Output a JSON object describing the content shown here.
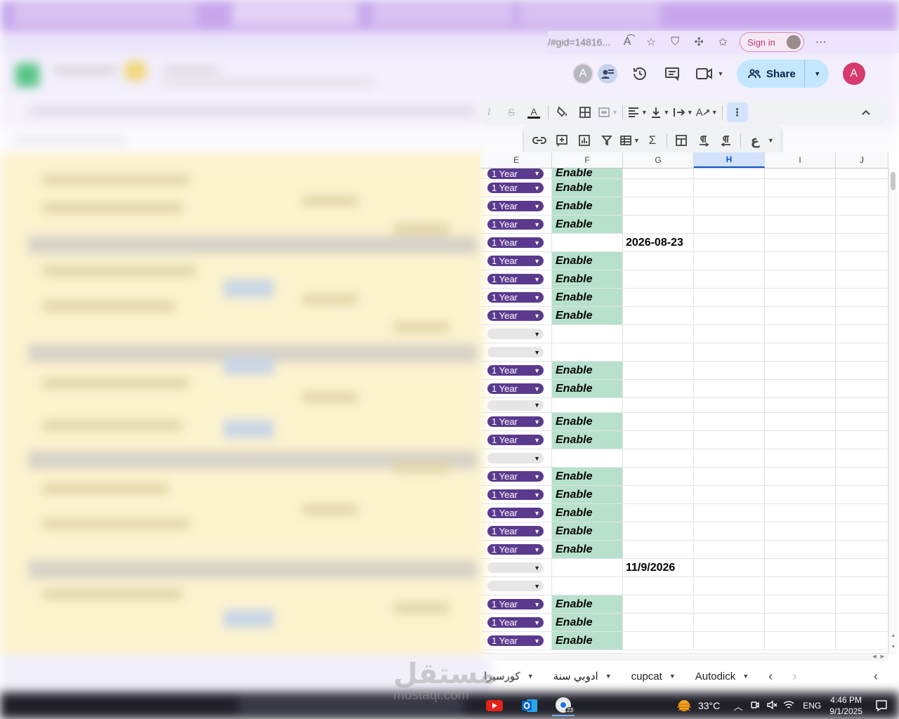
{
  "browser": {
    "url_fragment": "/#gid=14816...",
    "signin_label": "Sign in"
  },
  "header": {
    "avatar_letter": "A",
    "share_label": "Share",
    "account_letter": "A"
  },
  "columns": [
    "E",
    "F",
    "G",
    "H",
    "I",
    "J"
  ],
  "selected_column": "H",
  "rows": [
    {
      "chip": "1 Year",
      "f": "Enable",
      "g": ""
    },
    {
      "chip": "1 Year",
      "f": "Enable",
      "g": ""
    },
    {
      "chip": "1 Year",
      "f": "Enable",
      "g": ""
    },
    {
      "chip": "1 Year",
      "f": "Enable",
      "g": ""
    },
    {
      "chip": "1 Year",
      "f": "",
      "g": "2026-08-23"
    },
    {
      "chip": "1 Year",
      "f": "Enable",
      "g": ""
    },
    {
      "chip": "1 Year",
      "f": "Enable",
      "g": ""
    },
    {
      "chip": "1 Year",
      "f": "Enable",
      "g": ""
    },
    {
      "chip": "1 Year",
      "f": "Enable",
      "g": ""
    },
    {
      "chip": "",
      "f": "",
      "g": ""
    },
    {
      "chip": "",
      "f": "",
      "g": ""
    },
    {
      "chip": "1 Year",
      "f": "Enable",
      "g": ""
    },
    {
      "chip": "1 Year",
      "f": "Enable",
      "g": ""
    },
    {
      "chip": "",
      "f": "",
      "g": ""
    },
    {
      "chip": "1 Year",
      "f": "Enable",
      "g": ""
    },
    {
      "chip": "1 Year",
      "f": "Enable",
      "g": ""
    },
    {
      "chip": "",
      "f": "",
      "g": ""
    },
    {
      "chip": "1 Year",
      "f": "Enable",
      "g": ""
    },
    {
      "chip": "1 Year",
      "f": "Enable",
      "g": ""
    },
    {
      "chip": "1 Year",
      "f": "Enable",
      "g": ""
    },
    {
      "chip": "1 Year",
      "f": "Enable",
      "g": ""
    },
    {
      "chip": "1 Year",
      "f": "Enable",
      "g": ""
    },
    {
      "chip": "",
      "f": "",
      "g": "11/9/2026"
    },
    {
      "chip": "",
      "f": "",
      "g": ""
    },
    {
      "chip": "1 Year",
      "f": "Enable",
      "g": ""
    },
    {
      "chip": "1 Year",
      "f": "Enable",
      "g": ""
    },
    {
      "chip": "1 Year",
      "f": "Enable",
      "g": ""
    }
  ],
  "sheet_tabs": [
    "كورسيرا",
    "ادوبي سنة",
    "cupcat",
    "Autodick"
  ],
  "watermark": {
    "logo_text": "مستقل",
    "site_text": "mostaql.com"
  },
  "taskbar": {
    "weather_temp": "33°C",
    "language": "ENG",
    "time": "4:46 PM",
    "date": "9/1/2025",
    "chrome_badge": "23"
  },
  "colors": {
    "chip_purple": "#5b3a8e",
    "enable_green": "#b7e1cd",
    "share_blue": "#c2e7ff",
    "account_pink": "#d63a6e"
  }
}
